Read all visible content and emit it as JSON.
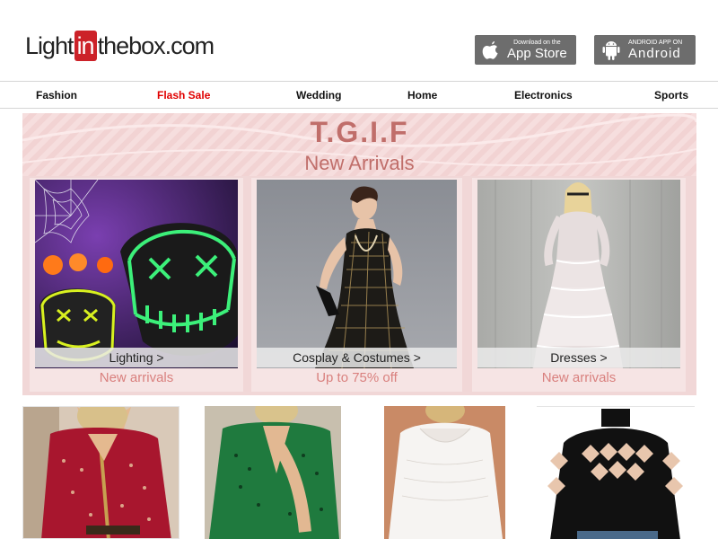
{
  "brand": {
    "part1": "Light",
    "part2": "in",
    "part3": "thebox",
    "part4": ".com"
  },
  "apps": {
    "appstore": {
      "small": "Download on the",
      "big": "App Store"
    },
    "android": {
      "small": "ANDROID APP ON",
      "big": "Android"
    }
  },
  "nav": {
    "items": [
      {
        "label": "Fashion"
      },
      {
        "label": "Flash Sale"
      },
      {
        "label": "Wedding"
      },
      {
        "label": "Home"
      },
      {
        "label": "Electronics"
      },
      {
        "label": "Sports"
      }
    ]
  },
  "banner": {
    "title": "T.G.I.F",
    "subtitle": "New Arrivals",
    "cards": [
      {
        "label": "Lighting >",
        "sub": "New arrivals"
      },
      {
        "label": "Cosplay & Costumes >",
        "sub": "Up to 75% off"
      },
      {
        "label": "Dresses >",
        "sub": "New arrivals"
      }
    ]
  },
  "colors": {
    "accent": "#cc2229",
    "sale": "#e00000",
    "banner_text": "#c06e6a",
    "banner_sub": "#d9807e"
  }
}
